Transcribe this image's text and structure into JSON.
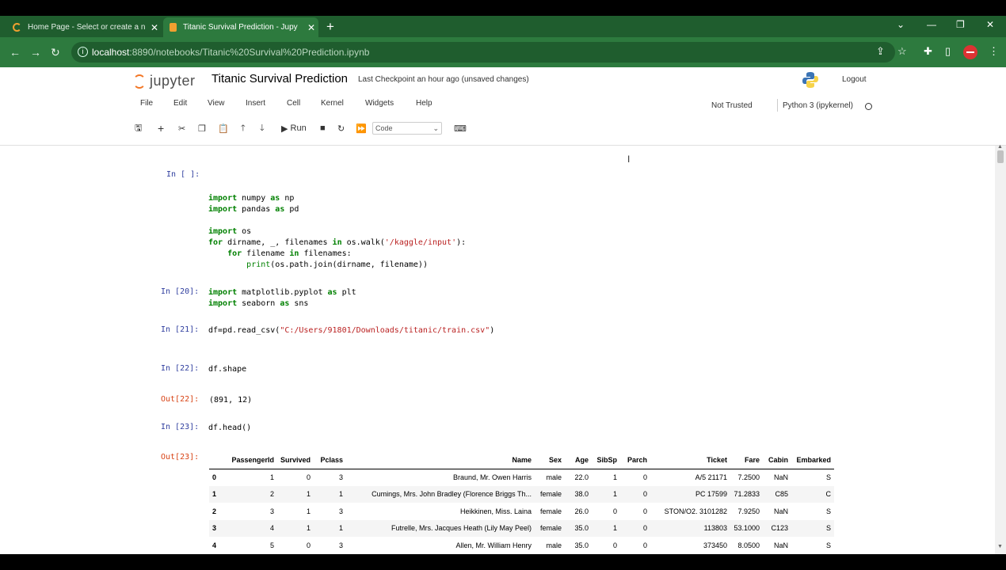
{
  "browser": {
    "tabs": [
      {
        "title": "Home Page - Select or create a n",
        "active": false
      },
      {
        "title": "Titanic Survival Prediction - Jupy",
        "active": true
      }
    ],
    "url_host": "localhost",
    "url_path": ":8890/notebooks/Titanic%20Survival%20Prediction.ipynb"
  },
  "header": {
    "logo_text": "jupyter",
    "notebook_title": "Titanic Survival Prediction",
    "checkpoint": "Last Checkpoint  an hour ago   (unsaved changes)",
    "logout_label": "Logout"
  },
  "menu": {
    "items": [
      "File",
      "Edit",
      "View",
      "Insert",
      "Cell",
      "Kernel",
      "Widgets",
      "Help"
    ],
    "not_trusted": "Not Trusted",
    "kernel_name": "Python 3 (ipykernel)"
  },
  "toolbar": {
    "run_label": "Run",
    "cell_type": "Code"
  },
  "cells": {
    "c1_prompt": "In [ ]:",
    "c2_prompt": "In [20]:",
    "c3_prompt": "In [21]:",
    "c4_prompt": "In [22]:",
    "c4_out_prompt": "Out[22]:",
    "c4_output": "(891, 12)",
    "c5_prompt": "In [23]:",
    "c5_code": "df.head()",
    "c5_out_prompt": "Out[23]:",
    "c4_code": "df.shape"
  },
  "dataframe": {
    "columns": [
      "PassengerId",
      "Survived",
      "Pclass",
      "Name",
      "Sex",
      "Age",
      "SibSp",
      "Parch",
      "Ticket",
      "Fare",
      "Cabin",
      "Embarked"
    ],
    "rows": [
      [
        "0",
        "1",
        "0",
        "3",
        "Braund, Mr. Owen Harris",
        "male",
        "22.0",
        "1",
        "0",
        "A/5 21171",
        "7.2500",
        "NaN",
        "S"
      ],
      [
        "1",
        "2",
        "1",
        "1",
        "Cumings, Mrs. John Bradley (Florence Briggs Th...",
        "female",
        "38.0",
        "1",
        "0",
        "PC 17599",
        "71.2833",
        "C85",
        "C"
      ],
      [
        "2",
        "3",
        "1",
        "3",
        "Heikkinen, Miss. Laina",
        "female",
        "26.0",
        "0",
        "0",
        "STON/O2. 3101282",
        "7.9250",
        "NaN",
        "S"
      ],
      [
        "3",
        "4",
        "1",
        "1",
        "Futrelle, Mrs. Jacques Heath (Lily May Peel)",
        "female",
        "35.0",
        "1",
        "0",
        "113803",
        "53.1000",
        "C123",
        "S"
      ],
      [
        "4",
        "5",
        "0",
        "3",
        "Allen, Mr. William Henry",
        "male",
        "35.0",
        "0",
        "0",
        "373450",
        "8.0500",
        "NaN",
        "S"
      ]
    ]
  },
  "colors": {
    "chrome": "#2d7a3e",
    "jupyter_orange": "#f37726",
    "prompt_in": "#303f9f",
    "prompt_out": "#d84315"
  }
}
